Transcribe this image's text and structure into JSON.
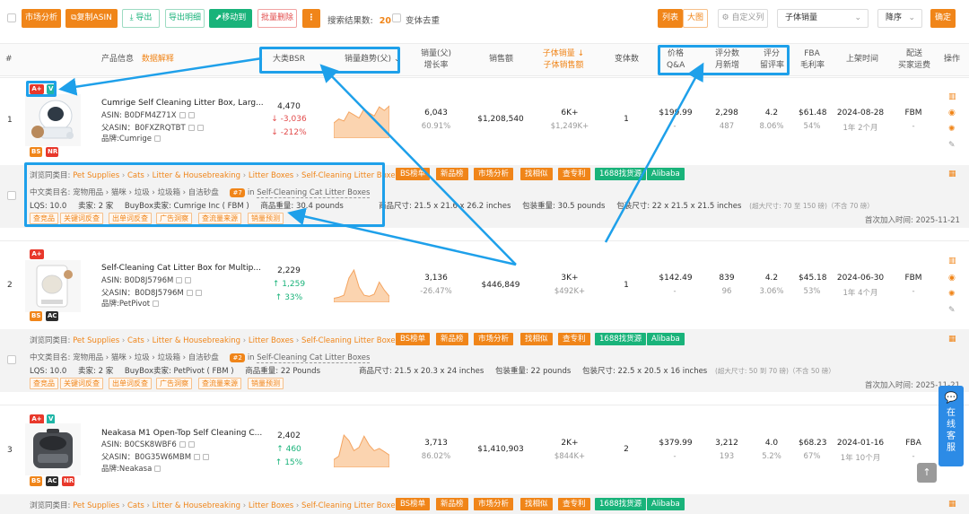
{
  "toolbar": {
    "market_analysis": "市场分析",
    "copy_asin": "复制ASIN",
    "export": "导出",
    "export_detail": "导出明细",
    "move_to": "移动到",
    "batch_delete": "批量删除",
    "more": "⋮",
    "result_label": "搜索结果数:",
    "result_count": "20",
    "dedupe_label": "变体去重",
    "view_list": "列表",
    "view_large": "大图",
    "custom_columns": "自定义列",
    "sort_field": "子体销量",
    "sort_order": "降序",
    "confirm": "确定"
  },
  "header": {
    "index": "#",
    "product_info": "产品信息",
    "data_explain": "数据解释",
    "bsr": "大类BSR",
    "sales_trend": "销量趋势(父)",
    "sales_parent": "销量(父)",
    "growth_rate": "增长率",
    "revenue": "销售额",
    "child_sales": "子体销量",
    "child_revenue": "子体销售额",
    "variants": "变体数",
    "price": "价格",
    "qa": "Q&A",
    "rating_count": "评分数",
    "monthly_new": "月新增",
    "rating": "评分",
    "retention": "留评率",
    "fba": "FBA",
    "margin": "毛利率",
    "launch": "上架时间",
    "delivery": "配送",
    "buyer_fee": "买家运费",
    "ops": "操作"
  },
  "rows": [
    {
      "index": "1",
      "badges_top": [
        "A+",
        "V"
      ],
      "badges_bottom": [
        "BS",
        "NR"
      ],
      "title": "Cumrige Self Cleaning Litter Box, Larg...",
      "asin": "ASIN: B0DFM4Z71X",
      "parent_asin": "父ASIN：B0FXZRQTBT",
      "brand": "品牌:Cumrige",
      "bsr": "4,470",
      "bsr_change": "↓ -3,036",
      "bsr_pct": "↓ -212%",
      "sales": "6,043",
      "growth": "60.91%",
      "revenue": "$1,208,540",
      "child_sales": "6K+",
      "child_revenue": "$1,249K+",
      "variants": "1",
      "price": "$199.99",
      "qa": "-",
      "rating_count": "2,298",
      "monthly_new": "487",
      "rating": "4.2",
      "retention": "8.06%",
      "fba": "$61.48",
      "margin": "54%",
      "launch": "2024-08-28",
      "age": "1年 2个月",
      "delivery": "FBM",
      "buyer_fee": "-",
      "category_label": "浏览同类目:",
      "categories": [
        "Pet Supplies",
        "Cats",
        "Litter & Housebreaking",
        "Litter Boxes",
        "Self-Cleaning Litter Boxes"
      ],
      "cn_category": "中文类目名: 宠物用品 › 猫咪 › 垃圾 › 垃圾箱 › 自洁砂盘",
      "rank_badge": "#7",
      "rank_in": "in",
      "rank_cat": "Self-Cleaning Cat Litter Boxes",
      "lqs": "LQS:  10.0",
      "sellers": "卖家:  2 家",
      "buybox": "BuyBox卖家:  Cumrige Inc ( FBM  )",
      "weight": "商品重量:  30.4 pounds",
      "size": "商品尺寸:  21.5 x 21.6 x 26.2 inches",
      "pkg_weight": "包装重量:  30.5 pounds",
      "pkg_size": "包装尺寸:  22 x 21.5 x 21.5 inches",
      "size_note": "(超大尺寸: 70 至 150 磅)（不含 70 磅）",
      "first_added": "首次加入时间:  2025-11-21",
      "trend": [
        30,
        38,
        34,
        52,
        46,
        40,
        58,
        50,
        44,
        62,
        55,
        64
      ]
    },
    {
      "index": "2",
      "badges_top": [
        "A+"
      ],
      "badges_bottom": [
        "BS",
        "AC"
      ],
      "title": "Self-Cleaning Cat Litter Box for Multip...",
      "asin": "ASIN: B0D8J5796M",
      "parent_asin": "父ASIN：B0D8J5796M",
      "brand": "品牌:PetPivot",
      "bsr": "2,229",
      "bsr_change": "↑ 1,259",
      "bsr_pct": "↑ 33%",
      "sales": "3,136",
      "growth": "-26.47%",
      "revenue": "$446,849",
      "child_sales": "3K+",
      "child_revenue": "$492K+",
      "variants": "1",
      "price": "$142.49",
      "qa": "-",
      "rating_count": "839",
      "monthly_new": "96",
      "rating": "4.2",
      "retention": "3.06%",
      "fba": "$45.18",
      "margin": "53%",
      "launch": "2024-06-30",
      "age": "1年 4个月",
      "delivery": "FBM",
      "buyer_fee": "-",
      "category_label": "浏览同类目:",
      "categories": [
        "Pet Supplies",
        "Cats",
        "Litter & Housebreaking",
        "Litter Boxes",
        "Self-Cleaning Litter Boxes"
      ],
      "cn_category": "中文类目名: 宠物用品 › 猫咪 › 垃圾 › 垃圾箱 › 自洁砂盘",
      "rank_badge": "#2",
      "rank_in": "in",
      "rank_cat": "Self-Cleaning Cat Litter Boxes",
      "lqs": "LQS:  10.0",
      "sellers": "卖家:  2 家",
      "buybox": "BuyBox卖家:  PetPivot ( FBM  )",
      "weight": "商品重量:  22 Pounds",
      "size": "商品尺寸:  21.5 x 20.3 x 24 inches",
      "pkg_weight": "包装重量:  22 pounds",
      "pkg_size": "包装尺寸:  22.5 x 20.5 x 16 inches",
      "size_note": "(超大尺寸: 50 到 70 磅)（不含 50 磅）",
      "first_added": "首次加入时间:  2025-11-21",
      "trend": [
        8,
        10,
        14,
        48,
        64,
        30,
        14,
        12,
        16,
        40,
        24,
        12
      ]
    },
    {
      "index": "3",
      "badges_top": [
        "A+",
        "V"
      ],
      "badges_bottom": [
        "BS",
        "AC",
        "NR"
      ],
      "title": "Neakasa M1 Open-Top Self Cleaning C...",
      "asin": "ASIN: B0CSK8WBF6",
      "parent_asin": "父ASIN：B0G35W6MBM",
      "brand": "品牌:Neakasa",
      "bsr": "2,402",
      "bsr_change": "↑ 460",
      "bsr_pct": "↑ 15%",
      "sales": "3,713",
      "growth": "86.02%",
      "revenue": "$1,410,903",
      "child_sales": "2K+",
      "child_revenue": "$844K+",
      "variants": "2",
      "price": "$379.99",
      "qa": "-",
      "rating_count": "3,212",
      "monthly_new": "193",
      "rating": "4.0",
      "retention": "5.2%",
      "fba": "$68.23",
      "margin": "67%",
      "launch": "2024-01-16",
      "age": "1年 10个月",
      "delivery": "FBA",
      "buyer_fee": "-",
      "category_label": "浏览同类目:",
      "categories": [
        "Pet Supplies",
        "Cats",
        "Litter & Housebreaking",
        "Litter Boxes",
        "Self-Cleaning Litter Boxes"
      ],
      "trend": [
        14,
        20,
        58,
        48,
        30,
        36,
        56,
        40,
        30,
        34,
        28,
        22
      ]
    }
  ],
  "tags": [
    "BS榜单",
    "新品榜",
    "市场分析",
    "找相似",
    "查专利",
    "1688找货源",
    "Alibaba"
  ],
  "keywords": [
    "查竞品",
    "关键词反查",
    "出单词反查",
    "广告洞察",
    "查流量来源",
    "销量预测"
  ],
  "float_service": "在线客服",
  "colors": {
    "accent": "#f08519",
    "green": "#19b37a",
    "highlight": "#1ea0ea"
  }
}
